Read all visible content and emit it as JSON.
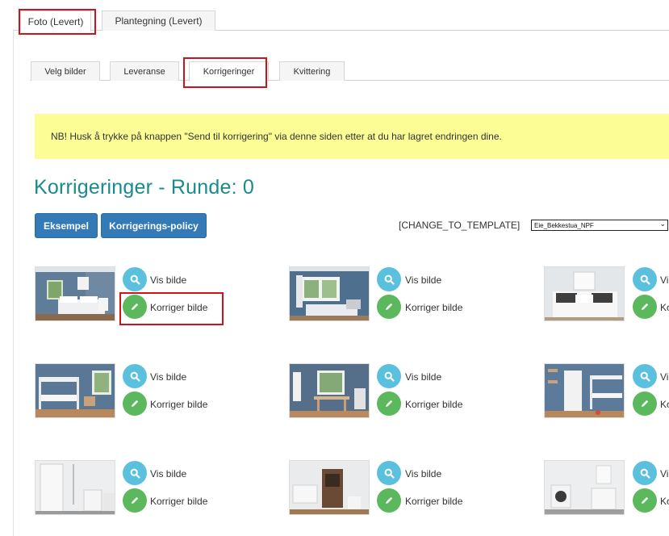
{
  "top_tabs": [
    {
      "label": "Foto (Levert)",
      "active": true
    },
    {
      "label": "Plantegning (Levert)",
      "active": false
    }
  ],
  "sub_tabs": [
    {
      "label": "Velg bilder",
      "active": false
    },
    {
      "label": "Leveranse",
      "active": false
    },
    {
      "label": "Korrigeringer",
      "active": true
    },
    {
      "label": "Kvittering",
      "active": false
    }
  ],
  "notice": "NB! Husk å trykke på knappen \"Send til korrigering\" via denne siden etter at du har lagret endringen dine.",
  "page_title": "Korrigeringer - Runde: 0",
  "buttons": {
    "example": "Eksempel",
    "policy": "Korrigerings-policy"
  },
  "template": {
    "label": "[CHANGE_TO_TEMPLATE]",
    "selected": "Eie_Bekkestua_NPF"
  },
  "actions": {
    "view": "Vis bilde",
    "edit": "Korriger bilde",
    "view_partial": "Vi",
    "edit_partial": "Ko"
  },
  "images": [
    {
      "room": "bedroom"
    },
    {
      "room": "bedroom-window"
    },
    {
      "room": "bedroom-white"
    },
    {
      "room": "bunk-room"
    },
    {
      "room": "desk-room"
    },
    {
      "room": "bunk-room-door"
    },
    {
      "room": "bathroom-shower"
    },
    {
      "room": "bathroom-door"
    },
    {
      "room": "bathroom-laundry"
    }
  ],
  "colors": {
    "accent_title": "#1b8a8a",
    "primary": "#337ab7",
    "info": "#5bc0de",
    "success": "#5cb85c",
    "highlight": "#d0121b",
    "notice_bg": "#fdfd96"
  }
}
